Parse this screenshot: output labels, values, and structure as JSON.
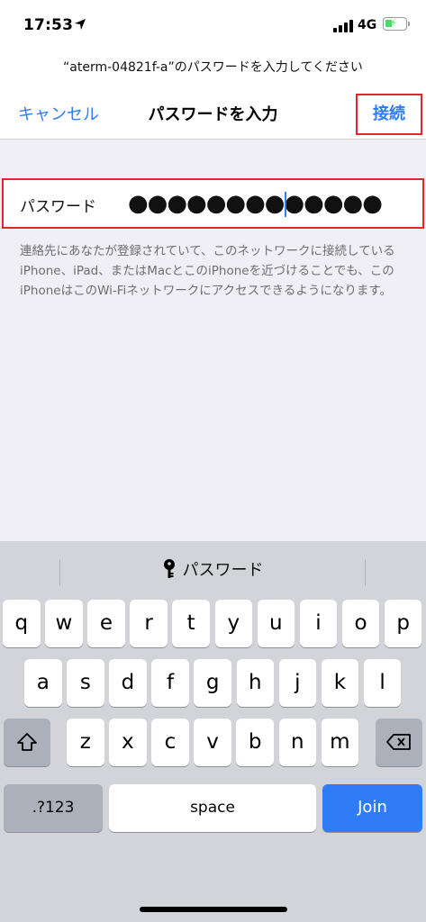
{
  "status": {
    "time": "17:53",
    "network": "4G",
    "icons": [
      "location-arrow-icon",
      "cell-signal-icon",
      "battery-charging-icon"
    ],
    "colors": {
      "battery": "#4cd964"
    }
  },
  "prompt": "“aterm-04821f-a”のパスワードを入力してください",
  "nav": {
    "cancel_label": "キャンセル",
    "title": "パスワードを入力",
    "join_label": "接続"
  },
  "password": {
    "label": "パスワード",
    "value": "●●●●●●●●●●●●●"
  },
  "help_text": "連絡先にあなたが登録されていて、このネットワークに接続しているiPhone、iPad、またはMacとこのiPhoneを近づけることでも、このiPhoneはこのWi-Fiネットワークにアクセスできるようになります。",
  "keyboard": {
    "suggestion": "パスワード",
    "suggestion_icon": "key-icon",
    "row1": [
      "q",
      "w",
      "e",
      "r",
      "t",
      "y",
      "u",
      "i",
      "o",
      "p"
    ],
    "row2": [
      "a",
      "s",
      "d",
      "f",
      "g",
      "h",
      "j",
      "k",
      "l"
    ],
    "row3": [
      "z",
      "x",
      "c",
      "v",
      "b",
      "n",
      "m"
    ],
    "shift_icon": "shift-icon",
    "delete_icon": "delete-icon",
    "num_label": ".?123",
    "space_label": "space",
    "join_label": "Join"
  },
  "colors": {
    "accent": "#2f7cf6",
    "highlight_border": "#e3262b",
    "background": "#f0eff5",
    "keyboard_bg": "#d2d4da"
  }
}
